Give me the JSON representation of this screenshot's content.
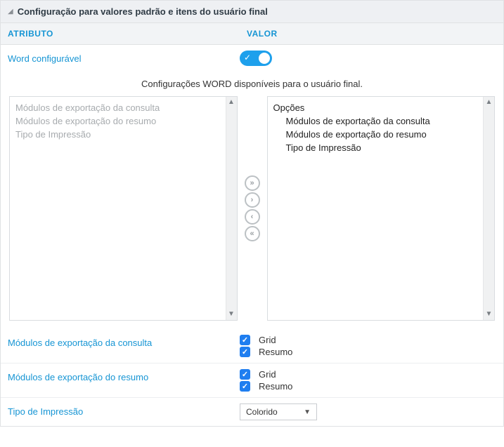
{
  "section": {
    "title": "Configuração para valores padrão e itens do usuário final"
  },
  "columns": {
    "attribute": "ATRIBUTO",
    "value": "VALOR"
  },
  "wordConfig": {
    "label": "Word configurável",
    "enabled": true
  },
  "dualList": {
    "caption": "Configurações WORD disponíveis para o usuário final.",
    "available": [
      "Módulos de exportação da consulta",
      "Módulos de exportação do resumo",
      "Tipo de Impressão"
    ],
    "selected": {
      "group": "Opções",
      "items": [
        "Módulos de exportação da consulta",
        "Módulos de exportação do resumo",
        "Tipo de Impressão"
      ]
    }
  },
  "exportConsulta": {
    "label": "Módulos de exportação da consulta",
    "options": [
      {
        "label": "Grid",
        "checked": true
      },
      {
        "label": "Resumo",
        "checked": true
      }
    ]
  },
  "exportResumo": {
    "label": "Módulos de exportação do resumo",
    "options": [
      {
        "label": "Grid",
        "checked": true
      },
      {
        "label": "Resumo",
        "checked": true
      }
    ]
  },
  "printType": {
    "label": "Tipo de Impressão",
    "value": "Colorido"
  }
}
